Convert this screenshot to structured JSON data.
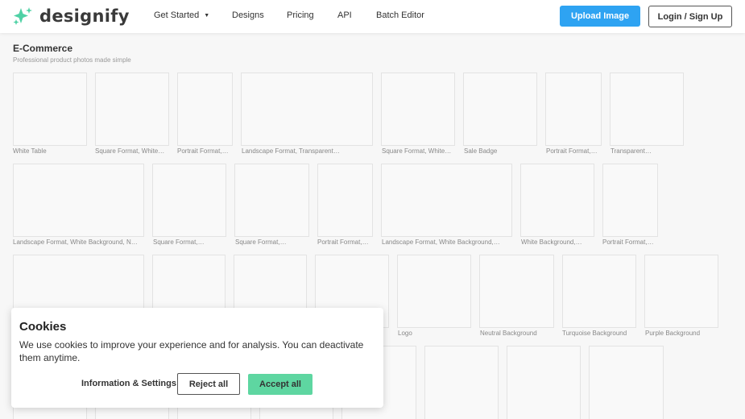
{
  "header": {
    "logo_text": "designify",
    "nav": {
      "get_started": "Get Started",
      "designs": "Designs",
      "pricing": "Pricing",
      "api": "API",
      "batch_editor": "Batch Editor"
    },
    "upload_label": "Upload Image",
    "login_label": "Login / Sign Up"
  },
  "category": {
    "title": "E-Commerce",
    "subtitle": "Professional product photos made simple"
  },
  "rows": [
    {
      "tiles": [
        {
          "label": "White Table"
        },
        {
          "label": "Square Format, White…"
        },
        {
          "label": "Portrait Format,…"
        },
        {
          "label": "Landscape Format, Transparent…"
        },
        {
          "label": "Square Format, White…"
        },
        {
          "label": "Sale Badge"
        },
        {
          "label": "Portrait Format,…"
        },
        {
          "label": "Transparent…"
        }
      ]
    },
    {
      "tiles": [
        {
          "label": "Landscape Format, White Background, N…"
        },
        {
          "label": "Square Format,…"
        },
        {
          "label": "Square Format,…"
        },
        {
          "label": "Portrait Format,…"
        },
        {
          "label": "Landscape Format, White Background,…"
        },
        {
          "label": "White Background,…"
        },
        {
          "label": "Portrait Format,…"
        }
      ]
    },
    {
      "tiles": [
        {
          "label": ""
        },
        {
          "label": ""
        },
        {
          "label": ""
        },
        {
          "label": ""
        },
        {
          "label": "Logo"
        },
        {
          "label": "Neutral Background"
        },
        {
          "label": "Turquoise Background"
        },
        {
          "label": "Purple Background"
        }
      ]
    }
  ],
  "cookie_banner": {
    "title": "Cookies",
    "text": "We use cookies to improve your experience and for analysis. You can deactivate them anytime.",
    "info_label": "Information & Settings",
    "reject_label": "Reject all",
    "accept_label": "Accept all"
  },
  "colors": {
    "primary": "#2ea3f2",
    "accept": "#5ed6a1",
    "logo_accent": "#4fd1a5"
  }
}
